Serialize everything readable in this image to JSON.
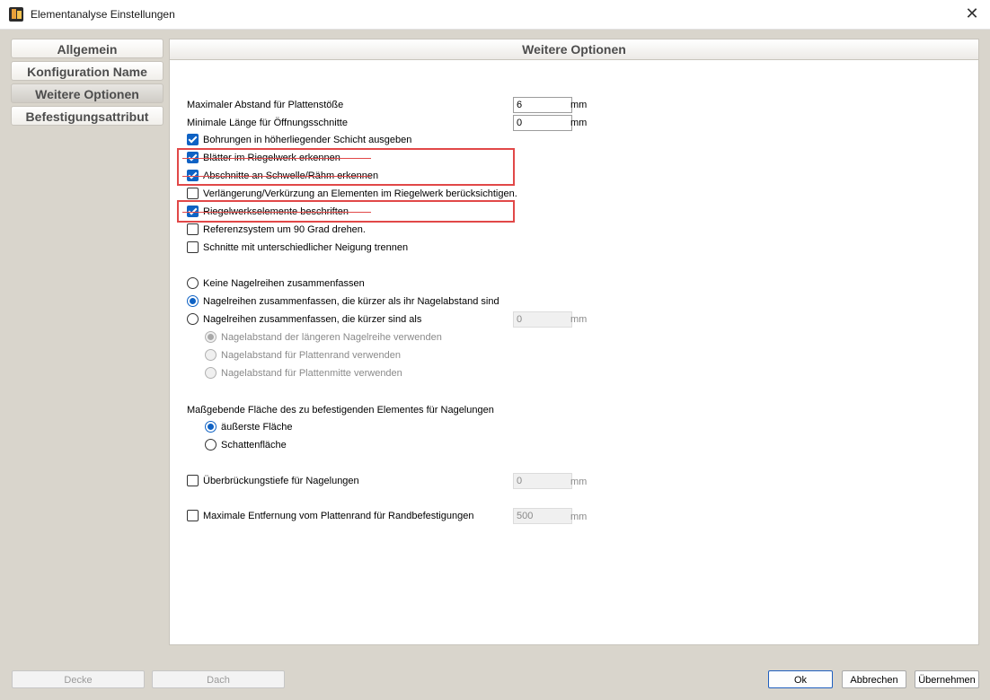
{
  "window": {
    "title": "Elementanalyse Einstellungen",
    "close_symbol": "✕"
  },
  "tabs": [
    {
      "label": "Allgemein"
    },
    {
      "label": "Konfiguration Name"
    },
    {
      "label": "Weitere Optionen"
    },
    {
      "label": "Befestigungsattribut"
    }
  ],
  "panel": {
    "header": "Weitere Optionen",
    "max_abstand": {
      "label": "Maximaler Abstand für Plattenstöße",
      "value": "6",
      "unit": "mm"
    },
    "min_laenge": {
      "label": "Minimale Länge für Öffnungsschnitte",
      "value": "0",
      "unit": "mm"
    },
    "checkboxes": [
      {
        "label": "Bohrungen in höherliegender Schicht ausgeben",
        "checked": true
      },
      {
        "label": "Blätter im Riegelwerk erkennen",
        "checked": true
      },
      {
        "label": "Abschnitte an Schwelle/Rähm erkennen",
        "checked": true
      },
      {
        "label": "Verlängerung/Verkürzung an Elementen im Riegelwerk berücksichtigen.",
        "checked": false
      },
      {
        "label": "Riegelwerkselemente beschriften",
        "checked": true
      },
      {
        "label": "Referenzsystem um 90 Grad drehen.",
        "checked": false
      },
      {
        "label": "Schnitte mit unterschiedlicher Neigung trennen",
        "checked": false
      }
    ],
    "nagel_radios": [
      {
        "label": "Keine Nagelreihen zusammenfassen",
        "selected": false
      },
      {
        "label": "Nagelreihen zusammenfassen, die kürzer als ihr Nagelabstand sind",
        "selected": true
      },
      {
        "label": "Nagelreihen zusammenfassen, die kürzer sind als",
        "selected": false
      }
    ],
    "nagel_field": {
      "value": "0",
      "unit": "mm"
    },
    "nagel_sub_radios": [
      {
        "label": "Nagelabstand der längeren Nagelreihe verwenden",
        "selected": true
      },
      {
        "label": "Nagelabstand für Plattenrand verwenden",
        "selected": false
      },
      {
        "label": "Nagelabstand für Plattenmitte verwenden",
        "selected": false
      }
    ],
    "flaeche_heading": "Maßgebende Fläche des zu befestigenden Elementes für Nagelungen",
    "flaeche_radios": [
      {
        "label": "äußerste Fläche",
        "selected": true
      },
      {
        "label": "Schattenfläche",
        "selected": false
      }
    ],
    "ueberbrueckung": {
      "label": "Überbrückungstiefe für Nagelungen",
      "checked": false,
      "value": "0",
      "unit": "mm"
    },
    "max_entfernung": {
      "label": "Maximale Entfernung vom Plattenrand für Randbefestigungen",
      "checked": false,
      "value": "500",
      "unit": "mm"
    }
  },
  "footer": {
    "decke": "Decke",
    "dach": "Dach",
    "ok": "Ok",
    "abbrechen": "Abbrechen",
    "uebernehmen": "Übernehmen"
  },
  "colors": {
    "accent": "#0f62c4",
    "highlight": "#e14848",
    "background": "#d9d5cc"
  }
}
